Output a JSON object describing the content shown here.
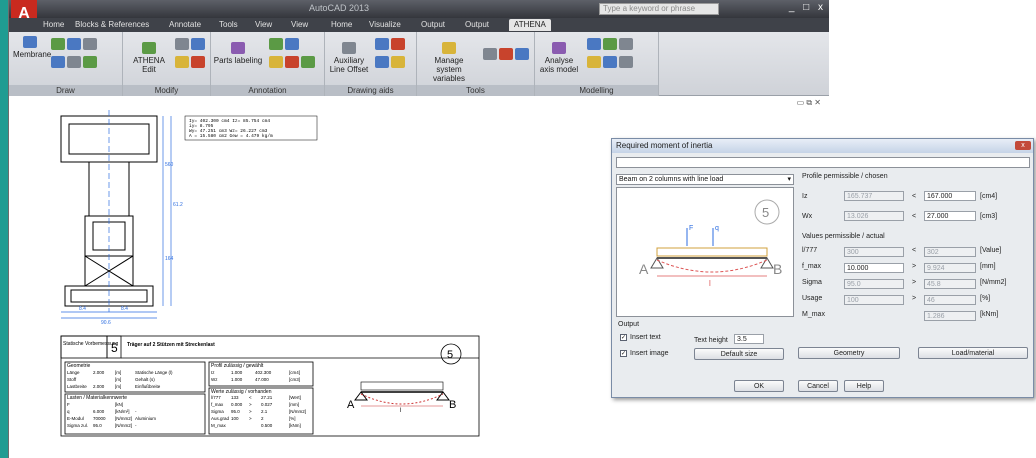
{
  "app": {
    "title": "AutoCAD 2013",
    "search_placeholder": "Type a keyword or phrase",
    "logo": "A",
    "controls": [
      "_",
      "□",
      "x"
    ]
  },
  "tabs": [
    "Home",
    "Blocks & References",
    "Annotate",
    "Tools",
    "View",
    "View",
    "Home",
    "Visualize",
    "Output",
    "Output",
    "ATHENA"
  ],
  "ribbon": {
    "panels": [
      "Draw",
      "Modify",
      "Annotation",
      "Drawing aids",
      "Tools",
      "Modelling"
    ],
    "items": {
      "membrane": "Membrane",
      "athena_edit": "ATHENA Edit",
      "parts_labeling": "Parts labeling",
      "auxiliary_line": "Auxiliary Line Offset",
      "manage_system": "Manage system variables",
      "analyse_axis": "Analyse axis model"
    }
  },
  "drawing": {
    "results_block": [
      "Iy=    402.300 cm4  Iz=    85.754 cm4",
      "iy=      8.795",
      "Wy=     47.251 cm3  Wz=     26.227 cm3",
      "A =     15.580 cm2  Gew =     4.479 kg/m"
    ],
    "dim_labels": [
      "560",
      "61.2",
      "164",
      "90.6",
      "8.4",
      "8.4",
      "52.5",
      "64.4"
    ],
    "stamp": {
      "left_title": "Statische Vorbemessung",
      "number": "5",
      "heading": "Träger auf 2 Stützen mit Streckenlast",
      "sub_geometrie": "Geometrie",
      "sub_lasten": "Lasten / Materialkennwerte",
      "geo_rows": [
        [
          "Länge",
          "2.000",
          "[m]",
          "Statische Länge (l)"
        ],
        [
          "Stoff",
          "",
          "[m]",
          "Gehalt (s)"
        ],
        [
          "Lastbreite",
          "2.000",
          "[m]",
          "Einflußbreite"
        ]
      ],
      "load_rows": [
        [
          "F",
          "",
          "[kN]",
          ""
        ],
        [
          "q",
          "6.000",
          "[kN/m²]",
          "-"
        ],
        [
          "E-Modul",
          "70000",
          "[N/mm2]",
          "Aluminium"
        ],
        [
          "Sigma zul.",
          "95.0",
          "[N/mm2]",
          "-"
        ]
      ],
      "profile_head": "Profil zulässig / gewählt",
      "profile_rows": [
        [
          "Iz",
          "1.000",
          "402.300",
          "[cm4]"
        ],
        [
          "Wz",
          "1.000",
          "47.000",
          "[cm3]"
        ]
      ],
      "werte_head": "Werte zulässig / vorhanden",
      "werte_rows": [
        [
          "l/777",
          "133",
          "<",
          "27.21",
          "[Wert]"
        ],
        [
          "f_max",
          "0.000",
          ">",
          "0.027",
          "[mm]"
        ],
        [
          "Sigma",
          "95.0",
          ">",
          "2.1",
          "[N/mm2]"
        ],
        [
          "Aus.grad",
          "100",
          ">",
          "2",
          "[%]"
        ],
        [
          "M_max",
          "",
          "",
          "0.500",
          "[kNm]"
        ]
      ],
      "circle_number": "5",
      "label_a": "A",
      "label_b": "B",
      "label_l": "l"
    }
  },
  "dialog": {
    "title": "Required moment of inertia",
    "close": "x",
    "load_case": "Beam on 2 columns with line load",
    "preview": {
      "circle": "5",
      "a": "A",
      "b": "B",
      "l": "l",
      "f": "F",
      "q": "q"
    },
    "profile_heading": "Profile permissible / chosen",
    "rows_profile": [
      {
        "label": "Iz",
        "perm": "165.737",
        "op": "<",
        "chosen": "167.000",
        "unit": "[cm4]"
      },
      {
        "label": "Wx",
        "perm": "13.026",
        "op": "<",
        "chosen": "27.000",
        "unit": "[cm3]"
      }
    ],
    "values_heading": "Values permissible / actual",
    "rows_values": [
      {
        "label": "l/777",
        "perm": "300",
        "op": "<",
        "act": "302",
        "unit": "[Value]"
      },
      {
        "label": "f_max",
        "perm": "10.000",
        "op": ">",
        "act": "9.924",
        "unit": "[mm]"
      },
      {
        "label": "Sigma",
        "perm": "95.0",
        "op": ">",
        "act": "45.8",
        "unit": "[N/mm2]"
      },
      {
        "label": "Usage",
        "perm": "100",
        "op": ">",
        "act": "46",
        "unit": "[%]"
      },
      {
        "label": "M_max",
        "perm": "",
        "op": "",
        "act": "1.286",
        "unit": "[kNm]"
      }
    ],
    "output_label": "Output",
    "insert_text": "Insert text",
    "insert_image": "Insert image",
    "text_height_label": "Text height",
    "text_height_value": "3.5",
    "default_size": "Default size",
    "geometry": "Geometry",
    "load_material": "Load/material",
    "ok": "OK",
    "cancel": "Cancel",
    "help": "Help"
  }
}
